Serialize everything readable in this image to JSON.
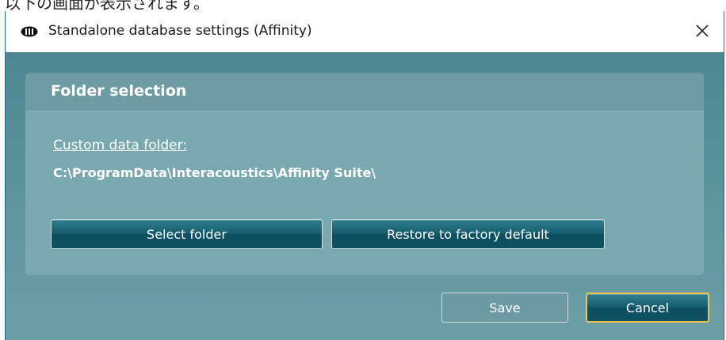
{
  "caption": {
    "text": "以下の画面が表示されます。"
  },
  "window": {
    "title": "Standalone database settings (Affinity)",
    "icon": "affinity-app-icon",
    "close_glyph": "✕"
  },
  "panel": {
    "header": "Folder selection",
    "folder_label": "Custom data folder:",
    "folder_path": "C:\\ProgramData\\Interacoustics\\Affinity Suite\\",
    "select_folder_label": "Select folder",
    "restore_label": "Restore to factory default"
  },
  "footer": {
    "save_label": "Save",
    "cancel_label": "Cancel"
  },
  "colors": {
    "client_bg": "#5b939d",
    "panel_bg": "#79a8b0",
    "button_dark": "#165d6e",
    "focus_border": "#f2c14e",
    "text": "#ffffff"
  }
}
